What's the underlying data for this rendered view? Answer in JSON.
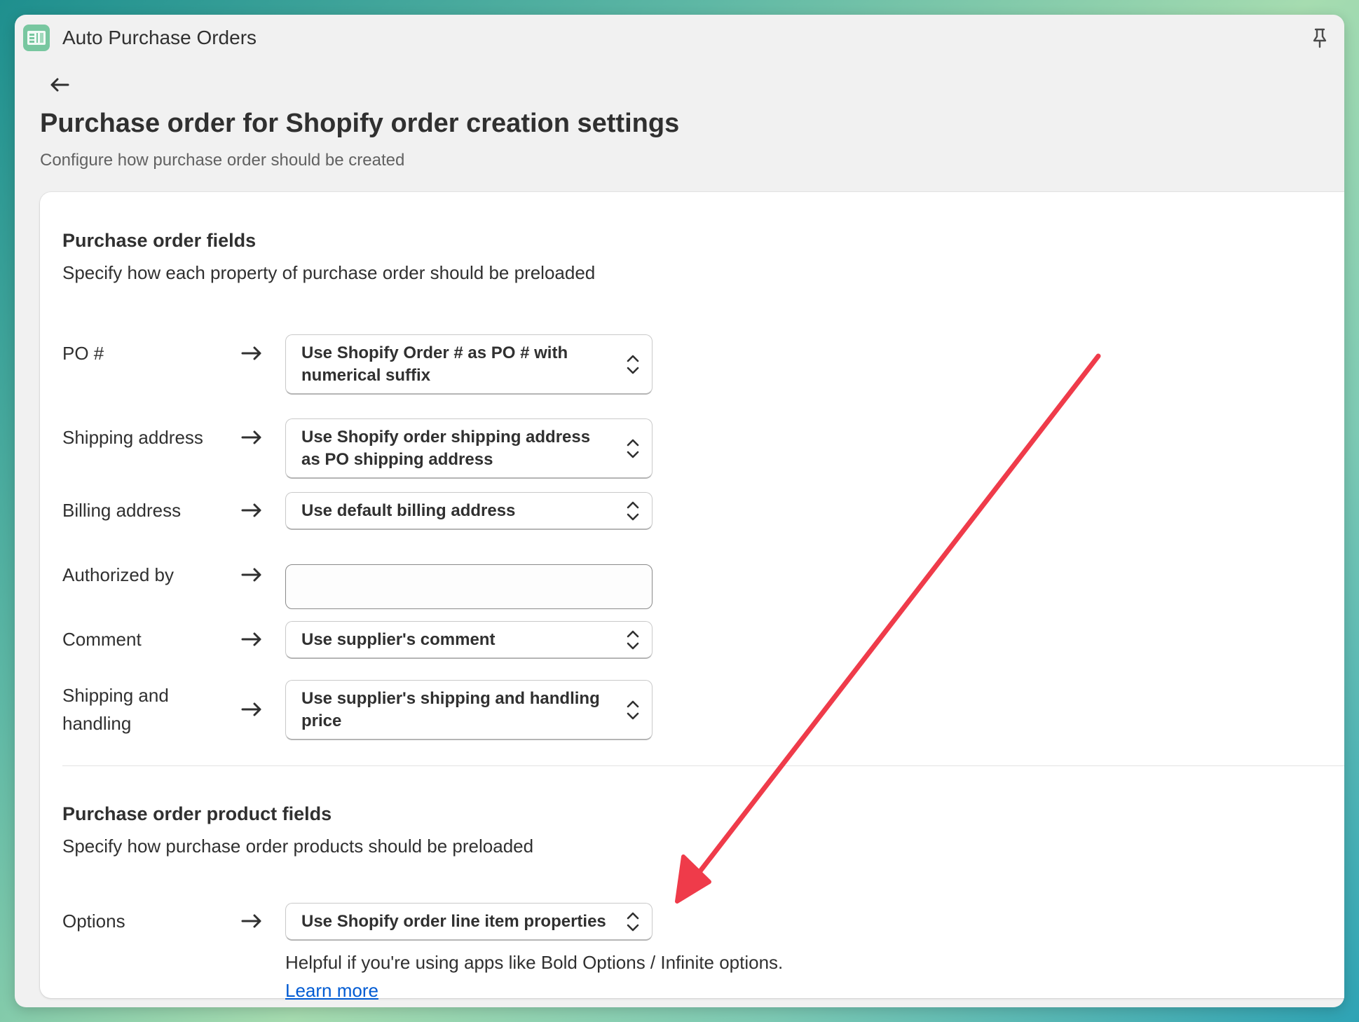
{
  "app": {
    "title": "Auto Purchase Orders",
    "icon": "app-logo-icon",
    "accent_color": "#78c7a0"
  },
  "header": {
    "back_icon": "arrow-left-icon",
    "pin_icon": "pin-icon",
    "title": "Purchase order for Shopify order creation settings",
    "subtitle": "Configure how purchase order should be created"
  },
  "po_fields": {
    "title": "Purchase order fields",
    "description": "Specify how each property of purchase order should be preloaded",
    "rows": [
      {
        "label": "PO #",
        "type": "select",
        "value": "Use Shopify Order # as PO # with numerical suffix"
      },
      {
        "label": "Shipping address",
        "type": "select",
        "value": "Use Shopify order shipping address as PO shipping address"
      },
      {
        "label": "Billing address",
        "type": "select",
        "value": "Use default billing address"
      },
      {
        "label": "Authorized by",
        "type": "input",
        "value": ""
      },
      {
        "label": "Comment",
        "type": "select",
        "value": "Use supplier's comment"
      },
      {
        "label": "Shipping and handling",
        "type": "select",
        "value": "Use supplier's shipping and handling price"
      }
    ]
  },
  "product_fields": {
    "title": "Purchase order product fields",
    "description": "Specify how purchase order products should be preloaded",
    "rows": [
      {
        "label": "Options",
        "type": "select",
        "value": "Use Shopify order line item properties"
      }
    ],
    "help_text": "Helpful if you're using apps like Bold Options / Infinite options.",
    "learn_more": "Learn more"
  },
  "annotation": {
    "color": "#ef3b4a",
    "icon": "red-arrow-annotation"
  }
}
